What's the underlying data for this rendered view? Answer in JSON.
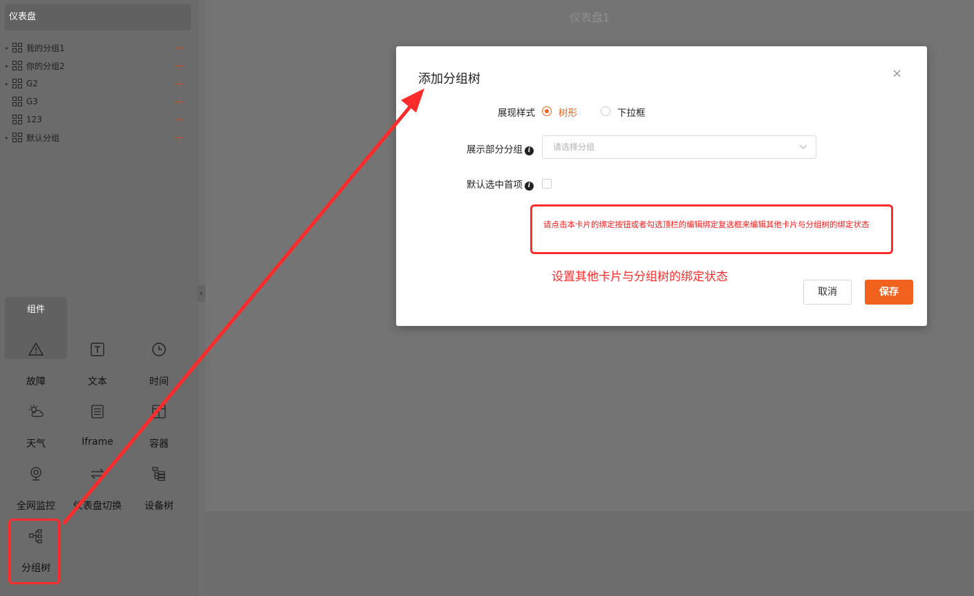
{
  "sidebar": {
    "dashboard_header": "仪表盘",
    "tree": [
      {
        "label": "我的分组1",
        "has_children": true
      },
      {
        "label": "你的分组2",
        "has_children": true
      },
      {
        "label": "G2",
        "has_children": true
      },
      {
        "label": "G3",
        "has_children": false
      },
      {
        "label": "123",
        "has_children": false
      },
      {
        "label": "默认分组",
        "has_children": true
      }
    ],
    "add_symbol": "+",
    "collapse_symbol": "‹",
    "components_header": "组件",
    "components": [
      {
        "label": "故障",
        "icon": "warning-icon"
      },
      {
        "label": "文本",
        "icon": "text-icon"
      },
      {
        "label": "时间",
        "icon": "clock-icon"
      },
      {
        "label": "天气",
        "icon": "weather-icon"
      },
      {
        "label": "Iframe",
        "icon": "iframe-icon"
      },
      {
        "label": "容器",
        "icon": "container-icon"
      },
      {
        "label": "全网监控",
        "icon": "camera-icon"
      },
      {
        "label": "仪表盘切换",
        "icon": "switch-icon"
      },
      {
        "label": "设备树",
        "icon": "device-tree-icon"
      },
      {
        "label": "分组树",
        "icon": "group-tree-icon"
      }
    ]
  },
  "canvas": {
    "title": "仪表盘1"
  },
  "modal": {
    "title": "添加分组树",
    "close_symbol": "×",
    "display_style_label": "展现样式",
    "options": [
      "树形",
      "下拉框"
    ],
    "selected_option": "树形",
    "partial_group_label": "展示部分分组",
    "select_placeholder": "请选择分组",
    "default_select_label": "默认选中首项",
    "info_symbol": "i",
    "note": "请点击本卡片的绑定按钮或者勾选顶栏的编辑绑定复选框来编辑其他卡片与分组树的绑定状态",
    "annotation": "设置其他卡片与分组树的绑定状态",
    "cancel_label": "取消",
    "save_label": "保存"
  },
  "colors": {
    "accent": "#f2621f",
    "annotation_red": "#ff2b2b"
  }
}
